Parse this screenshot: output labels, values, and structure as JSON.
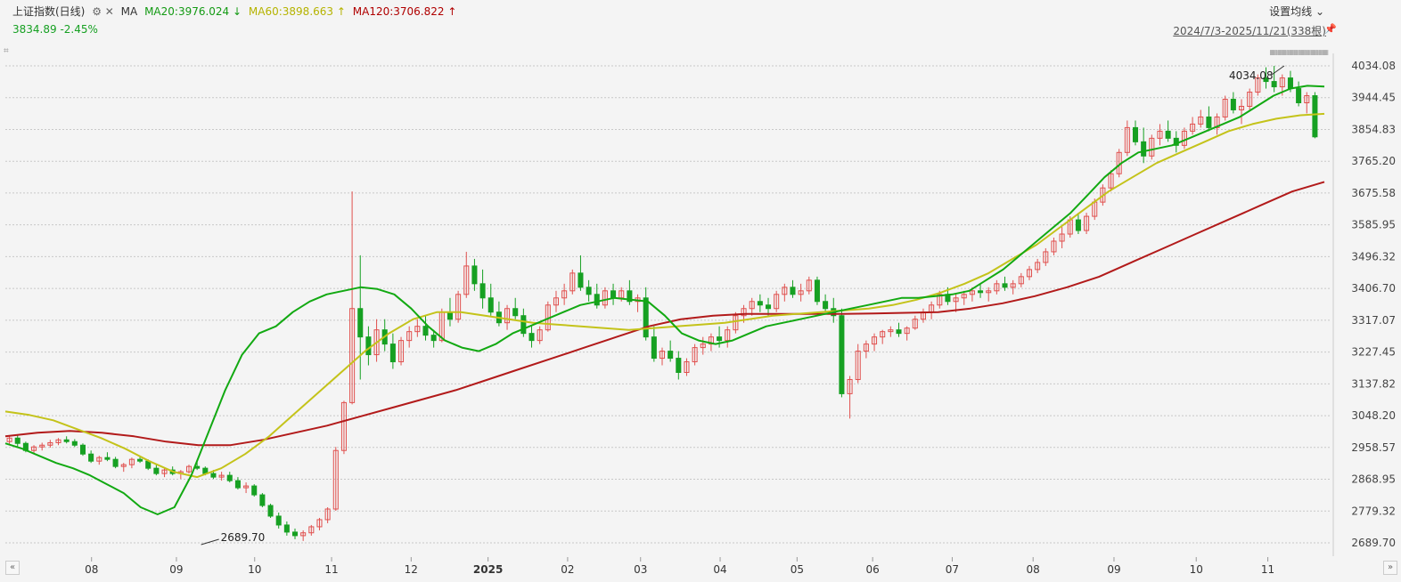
{
  "header": {
    "title": "上证指数(日线)",
    "icons": "⚙ ✕",
    "ma_label": "MA",
    "ma20": "MA20:3976.024 ↓",
    "ma60": "MA60:3898.663 ↑",
    "ma120": "MA120:3706.822 ↑",
    "price": "3834.89",
    "change": "-2.45%",
    "settings": "设置均线 ⌄",
    "range": "2024/7/3-2025/11/21(338根)"
  },
  "colors": {
    "up": "#e0504e",
    "down": "#16a022",
    "ma20": "#12a912",
    "ma60": "#c4c31a",
    "ma120": "#b21a1a",
    "grid": "#c8c8c8"
  },
  "chart_data": {
    "type": "candlestick",
    "yticks": [
      "4034.08",
      "3944.45",
      "3854.83",
      "3765.20",
      "3675.58",
      "3585.95",
      "3496.32",
      "3406.70",
      "3317.07",
      "3227.45",
      "3137.82",
      "3048.20",
      "2958.57",
      "2868.95",
      "2779.32",
      "2689.70"
    ],
    "ylim": [
      2689.7,
      4034.08
    ],
    "xticks": [
      {
        "label": "08",
        "x": 0.065
      },
      {
        "label": "09",
        "x": 0.129
      },
      {
        "label": "10",
        "x": 0.188
      },
      {
        "label": "11",
        "x": 0.246
      },
      {
        "label": "12",
        "x": 0.306
      },
      {
        "label": "2025",
        "x": 0.364
      },
      {
        "label": "02",
        "x": 0.424
      },
      {
        "label": "03",
        "x": 0.479
      },
      {
        "label": "04",
        "x": 0.539
      },
      {
        "label": "05",
        "x": 0.597
      },
      {
        "label": "06",
        "x": 0.654
      },
      {
        "label": "07",
        "x": 0.714
      },
      {
        "label": "08",
        "x": 0.775
      },
      {
        "label": "09",
        "x": 0.836
      },
      {
        "label": "10",
        "x": 0.898
      },
      {
        "label": "11",
        "x": 0.952
      }
    ],
    "annotations": [
      {
        "text": "2689.70",
        "x": 0.153,
        "y": 2689.7
      },
      {
        "text": "4034.08",
        "x": 0.963,
        "y": 4034.08
      }
    ],
    "kline": [
      [
        2975,
        2990,
        2965,
        2985
      ],
      [
        2985,
        2992,
        2960,
        2970
      ],
      [
        2970,
        2975,
        2945,
        2950
      ],
      [
        2950,
        2965,
        2940,
        2960
      ],
      [
        2960,
        2972,
        2950,
        2965
      ],
      [
        2965,
        2980,
        2958,
        2972
      ],
      [
        2972,
        2985,
        2965,
        2980
      ],
      [
        2980,
        2990,
        2970,
        2975
      ],
      [
        2975,
        2982,
        2960,
        2965
      ],
      [
        2965,
        2970,
        2935,
        2940
      ],
      [
        2940,
        2950,
        2915,
        2920
      ],
      [
        2920,
        2935,
        2910,
        2930
      ],
      [
        2930,
        2945,
        2920,
        2925
      ],
      [
        2925,
        2932,
        2900,
        2905
      ],
      [
        2905,
        2915,
        2890,
        2910
      ],
      [
        2910,
        2930,
        2900,
        2925
      ],
      [
        2925,
        2935,
        2915,
        2920
      ],
      [
        2920,
        2925,
        2895,
        2900
      ],
      [
        2900,
        2910,
        2880,
        2885
      ],
      [
        2885,
        2900,
        2875,
        2895
      ],
      [
        2895,
        2905,
        2880,
        2885
      ],
      [
        2885,
        2895,
        2870,
        2890
      ],
      [
        2890,
        2910,
        2885,
        2905
      ],
      [
        2905,
        2920,
        2895,
        2900
      ],
      [
        2900,
        2905,
        2880,
        2885
      ],
      [
        2885,
        2895,
        2870,
        2875
      ],
      [
        2875,
        2890,
        2865,
        2880
      ],
      [
        2880,
        2890,
        2860,
        2865
      ],
      [
        2865,
        2875,
        2840,
        2845
      ],
      [
        2845,
        2860,
        2830,
        2850
      ],
      [
        2850,
        2855,
        2820,
        2825
      ],
      [
        2825,
        2830,
        2790,
        2795
      ],
      [
        2795,
        2800,
        2760,
        2765
      ],
      [
        2765,
        2775,
        2730,
        2740
      ],
      [
        2740,
        2750,
        2710,
        2720
      ],
      [
        2720,
        2730,
        2700,
        2710
      ],
      [
        2710,
        2725,
        2695,
        2718
      ],
      [
        2718,
        2740,
        2710,
        2735
      ],
      [
        2735,
        2760,
        2725,
        2755
      ],
      [
        2755,
        2790,
        2745,
        2785
      ],
      [
        2785,
        2960,
        2780,
        2950
      ],
      [
        2950,
        3090,
        2940,
        3085
      ],
      [
        3085,
        3680,
        3080,
        3350
      ],
      [
        3350,
        3500,
        3150,
        3270
      ],
      [
        3270,
        3300,
        3190,
        3220
      ],
      [
        3220,
        3320,
        3200,
        3290
      ],
      [
        3290,
        3320,
        3230,
        3250
      ],
      [
        3250,
        3280,
        3180,
        3200
      ],
      [
        3200,
        3270,
        3190,
        3260
      ],
      [
        3260,
        3300,
        3240,
        3285
      ],
      [
        3285,
        3320,
        3270,
        3300
      ],
      [
        3300,
        3330,
        3260,
        3275
      ],
      [
        3275,
        3290,
        3240,
        3260
      ],
      [
        3260,
        3350,
        3255,
        3340
      ],
      [
        3340,
        3380,
        3300,
        3320
      ],
      [
        3320,
        3400,
        3310,
        3390
      ],
      [
        3390,
        3510,
        3380,
        3470
      ],
      [
        3470,
        3490,
        3400,
        3420
      ],
      [
        3420,
        3460,
        3350,
        3380
      ],
      [
        3380,
        3420,
        3330,
        3340
      ],
      [
        3340,
        3370,
        3300,
        3310
      ],
      [
        3310,
        3360,
        3290,
        3350
      ],
      [
        3350,
        3380,
        3320,
        3330
      ],
      [
        3330,
        3350,
        3270,
        3280
      ],
      [
        3280,
        3300,
        3240,
        3260
      ],
      [
        3260,
        3300,
        3250,
        3290
      ],
      [
        3290,
        3370,
        3285,
        3360
      ],
      [
        3360,
        3400,
        3340,
        3380
      ],
      [
        3380,
        3420,
        3360,
        3400
      ],
      [
        3400,
        3460,
        3390,
        3450
      ],
      [
        3450,
        3500,
        3400,
        3410
      ],
      [
        3410,
        3430,
        3370,
        3390
      ],
      [
        3390,
        3420,
        3350,
        3360
      ],
      [
        3360,
        3410,
        3350,
        3400
      ],
      [
        3400,
        3420,
        3360,
        3380
      ],
      [
        3380,
        3410,
        3370,
        3400
      ],
      [
        3400,
        3430,
        3360,
        3370
      ],
      [
        3370,
        3390,
        3340,
        3380
      ],
      [
        3380,
        3410,
        3260,
        3270
      ],
      [
        3270,
        3300,
        3200,
        3210
      ],
      [
        3210,
        3240,
        3190,
        3230
      ],
      [
        3230,
        3260,
        3200,
        3210
      ],
      [
        3210,
        3230,
        3150,
        3170
      ],
      [
        3170,
        3210,
        3160,
        3200
      ],
      [
        3200,
        3250,
        3190,
        3240
      ],
      [
        3240,
        3270,
        3220,
        3250
      ],
      [
        3250,
        3280,
        3230,
        3270
      ],
      [
        3270,
        3300,
        3240,
        3260
      ],
      [
        3260,
        3300,
        3240,
        3290
      ],
      [
        3290,
        3340,
        3280,
        3330
      ],
      [
        3330,
        3360,
        3310,
        3350
      ],
      [
        3350,
        3380,
        3330,
        3370
      ],
      [
        3370,
        3390,
        3340,
        3360
      ],
      [
        3360,
        3380,
        3330,
        3350
      ],
      [
        3350,
        3400,
        3340,
        3390
      ],
      [
        3390,
        3420,
        3370,
        3410
      ],
      [
        3410,
        3430,
        3380,
        3390
      ],
      [
        3390,
        3420,
        3370,
        3400
      ],
      [
        3400,
        3440,
        3390,
        3430
      ],
      [
        3430,
        3440,
        3360,
        3370
      ],
      [
        3370,
        3390,
        3340,
        3350
      ],
      [
        3350,
        3380,
        3310,
        3330
      ],
      [
        3330,
        3350,
        3100,
        3110
      ],
      [
        3110,
        3160,
        3040,
        3150
      ],
      [
        3150,
        3250,
        3140,
        3230
      ],
      [
        3230,
        3260,
        3210,
        3250
      ],
      [
        3250,
        3280,
        3230,
        3270
      ],
      [
        3270,
        3290,
        3250,
        3285
      ],
      [
        3285,
        3300,
        3270,
        3290
      ],
      [
        3290,
        3310,
        3270,
        3280
      ],
      [
        3280,
        3300,
        3260,
        3295
      ],
      [
        3295,
        3330,
        3290,
        3320
      ],
      [
        3320,
        3350,
        3310,
        3340
      ],
      [
        3340,
        3370,
        3320,
        3360
      ],
      [
        3360,
        3400,
        3350,
        3390
      ],
      [
        3390,
        3410,
        3360,
        3370
      ],
      [
        3370,
        3390,
        3340,
        3380
      ],
      [
        3380,
        3400,
        3360,
        3390
      ],
      [
        3390,
        3410,
        3370,
        3400
      ],
      [
        3400,
        3420,
        3380,
        3395
      ],
      [
        3395,
        3410,
        3370,
        3400
      ],
      [
        3400,
        3430,
        3390,
        3420
      ],
      [
        3420,
        3440,
        3400,
        3410
      ],
      [
        3410,
        3430,
        3390,
        3420
      ],
      [
        3420,
        3450,
        3410,
        3440
      ],
      [
        3440,
        3470,
        3430,
        3460
      ],
      [
        3460,
        3490,
        3450,
        3480
      ],
      [
        3480,
        3520,
        3470,
        3510
      ],
      [
        3510,
        3550,
        3500,
        3540
      ],
      [
        3540,
        3580,
        3520,
        3560
      ],
      [
        3560,
        3610,
        3550,
        3600
      ],
      [
        3600,
        3620,
        3560,
        3570
      ],
      [
        3570,
        3620,
        3560,
        3610
      ],
      [
        3610,
        3660,
        3600,
        3650
      ],
      [
        3650,
        3700,
        3640,
        3690
      ],
      [
        3690,
        3740,
        3680,
        3730
      ],
      [
        3730,
        3800,
        3720,
        3790
      ],
      [
        3790,
        3880,
        3780,
        3860
      ],
      [
        3860,
        3880,
        3810,
        3820
      ],
      [
        3820,
        3860,
        3760,
        3780
      ],
      [
        3780,
        3840,
        3770,
        3830
      ],
      [
        3830,
        3870,
        3810,
        3850
      ],
      [
        3850,
        3880,
        3820,
        3830
      ],
      [
        3830,
        3850,
        3790,
        3810
      ],
      [
        3810,
        3860,
        3800,
        3850
      ],
      [
        3850,
        3890,
        3840,
        3870
      ],
      [
        3870,
        3910,
        3860,
        3890
      ],
      [
        3890,
        3920,
        3850,
        3860
      ],
      [
        3860,
        3900,
        3840,
        3890
      ],
      [
        3890,
        3950,
        3880,
        3940
      ],
      [
        3940,
        3960,
        3900,
        3910
      ],
      [
        3910,
        3940,
        3870,
        3920
      ],
      [
        3920,
        3970,
        3910,
        3960
      ],
      [
        3960,
        4010,
        3950,
        4000
      ],
      [
        4000,
        4030,
        3970,
        3990
      ],
      [
        3990,
        4034,
        3960,
        3975
      ],
      [
        3975,
        4010,
        3950,
        4000
      ],
      [
        4000,
        4020,
        3960,
        3970
      ],
      [
        3970,
        3990,
        3920,
        3930
      ],
      [
        3930,
        3960,
        3900,
        3950
      ],
      [
        3950,
        3960,
        3830,
        3834
      ]
    ],
    "ma20": [
      2970,
      2955,
      2935,
      2915,
      2900,
      2880,
      2855,
      2830,
      2790,
      2770,
      2790,
      2880,
      3000,
      3120,
      3220,
      3280,
      3300,
      3340,
      3370,
      3390,
      3400,
      3410,
      3405,
      3390,
      3350,
      3300,
      3260,
      3240,
      3230,
      3250,
      3280,
      3300,
      3320,
      3340,
      3360,
      3370,
      3380,
      3375,
      3370,
      3330,
      3280,
      3260,
      3250,
      3260,
      3280,
      3300,
      3310,
      3320,
      3330,
      3340,
      3350,
      3360,
      3370,
      3380,
      3380,
      3385,
      3390,
      3400,
      3430,
      3460,
      3500,
      3540,
      3580,
      3620,
      3670,
      3720,
      3760,
      3790,
      3800,
      3810,
      3830,
      3850,
      3870,
      3890,
      3920,
      3950,
      3970,
      3978,
      3976
    ],
    "ma60": [
      3060,
      3050,
      3035,
      3010,
      2985,
      2955,
      2920,
      2890,
      2875,
      2900,
      2940,
      2990,
      3050,
      3110,
      3170,
      3230,
      3280,
      3320,
      3340,
      3340,
      3330,
      3320,
      3310,
      3305,
      3300,
      3295,
      3290,
      3295,
      3300,
      3305,
      3310,
      3320,
      3330,
      3335,
      3340,
      3345,
      3350,
      3360,
      3375,
      3395,
      3420,
      3450,
      3490,
      3530,
      3580,
      3630,
      3680,
      3720,
      3760,
      3790,
      3820,
      3850,
      3870,
      3885,
      3895,
      3899
    ],
    "ma120": [
      2990,
      3000,
      3005,
      3000,
      2990,
      2975,
      2965,
      2965,
      2980,
      3000,
      3020,
      3045,
      3070,
      3095,
      3120,
      3150,
      3180,
      3210,
      3240,
      3270,
      3300,
      3320,
      3330,
      3335,
      3335,
      3335,
      3335,
      3336,
      3338,
      3340,
      3350,
      3365,
      3385,
      3410,
      3440,
      3480,
      3520,
      3560,
      3600,
      3640,
      3680,
      3707
    ]
  }
}
